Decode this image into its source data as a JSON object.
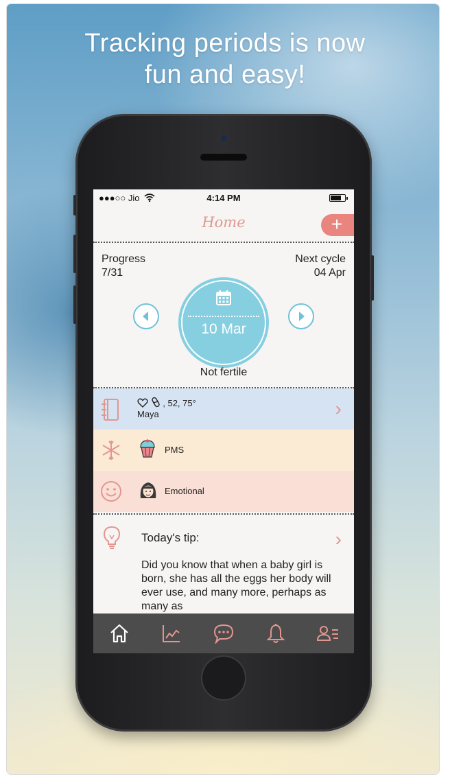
{
  "promo": {
    "headline_line1": "Tracking periods is now",
    "headline_line2": "fun and easy!"
  },
  "status_bar": {
    "carrier": "●●●○○ Jio",
    "time": "4:14 PM",
    "battery_level": 0.75
  },
  "nav": {
    "title": "Home",
    "add_label": "+"
  },
  "cycle": {
    "progress_label": "Progress",
    "progress_value": "7/31",
    "next_label": "Next cycle",
    "next_value": "04 Apr",
    "current_date": "10 Mar",
    "fertility_status": "Not fertile"
  },
  "entries": [
    {
      "icon": "journal-icon",
      "stats": ", 52, 75°",
      "name": "Maya",
      "background": "#d6e3f2"
    },
    {
      "icon": "asterisk-icon",
      "sub_icon": "cupcake-icon",
      "label": "PMS",
      "background": "#fcebd4"
    },
    {
      "icon": "smiley-icon",
      "sub_icon": "girl-face-icon",
      "label": "Emotional",
      "background": "#fadfd6"
    }
  ],
  "tip": {
    "title": "Today's tip:",
    "body": "Did you know that when a baby girl is born, she has all the eggs her body will ever use, and many more, perhaps as many as"
  },
  "tabs": [
    {
      "icon": "home-icon",
      "color": "#ffffff"
    },
    {
      "icon": "chart-icon",
      "color": "#e29690"
    },
    {
      "icon": "chat-icon",
      "color": "#e29690"
    },
    {
      "icon": "bell-icon",
      "color": "#e29690"
    },
    {
      "icon": "profile-list-icon",
      "color": "#e29690"
    }
  ],
  "colors": {
    "accent": "#e29690",
    "circle": "#86cfe0",
    "add_button": "#e9847e",
    "tabbar": "#4d4c4c"
  }
}
